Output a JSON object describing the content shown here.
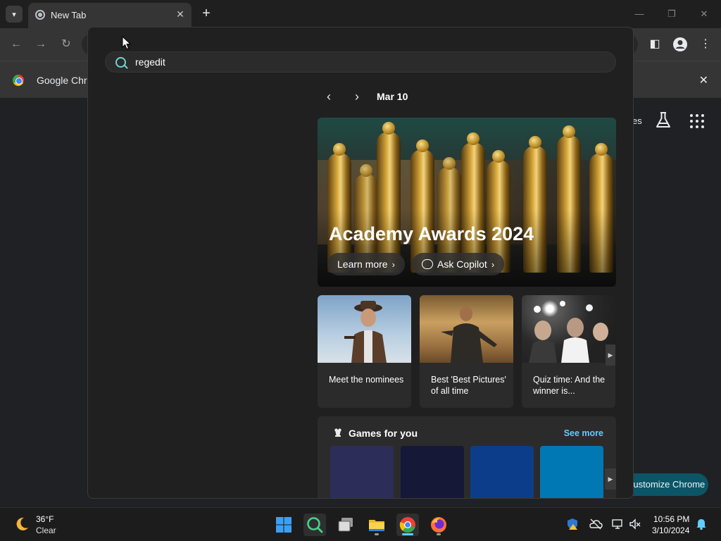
{
  "browser": {
    "tab_title": "New Tab",
    "tab_close_symbol": "✕",
    "new_tab_symbol": "+",
    "infobar_text": "Google Chro",
    "infobar_close_symbol": "✕",
    "ntp_partial_text": "es",
    "customize_label": "Customize Chrome"
  },
  "search": {
    "query": "regedit",
    "date": "Mar 10"
  },
  "hero": {
    "title": "Academy Awards 2024",
    "learn_more": "Learn more",
    "ask_copilot": "Ask Copilot"
  },
  "cards": [
    {
      "text": "Meet the nominees"
    },
    {
      "text": "Best 'Best Pictures' of all time"
    },
    {
      "text": "Quiz time: And the winner is..."
    }
  ],
  "games": {
    "title": "Games for you",
    "see_more": "See more",
    "tile_colors": [
      "#2d2d5a",
      "#151836",
      "#0b3d8a",
      "#0078b4"
    ]
  },
  "taskbar": {
    "weather_temp": "36°F",
    "weather_condition": "Clear",
    "time": "10:56 PM",
    "date": "3/10/2024"
  },
  "colors": {
    "accent": "#60cdff",
    "search_accent": "#6fd3d0",
    "customize_bg": "#0b5567"
  },
  "icons": [
    "chevron-down-icon",
    "chrome-icon",
    "close-icon",
    "plus-icon",
    "minimize-icon",
    "restore-icon",
    "back-icon",
    "forward-icon",
    "reload-icon",
    "side-panel-icon",
    "profile-icon",
    "kebab-menu-icon",
    "google-chrome-logo-icon",
    "labs-flask-icon",
    "apps-grid-icon",
    "search-icon",
    "chevron-left-icon",
    "chevron-right-icon",
    "copilot-chat-icon",
    "games-icon",
    "moon-icon",
    "windows-start-icon",
    "windows-search-icon",
    "task-view-icon",
    "file-explorer-icon",
    "firefox-icon",
    "defender-icon",
    "onedrive-icon",
    "network-icon",
    "volume-muted-icon",
    "notification-bell-icon"
  ]
}
